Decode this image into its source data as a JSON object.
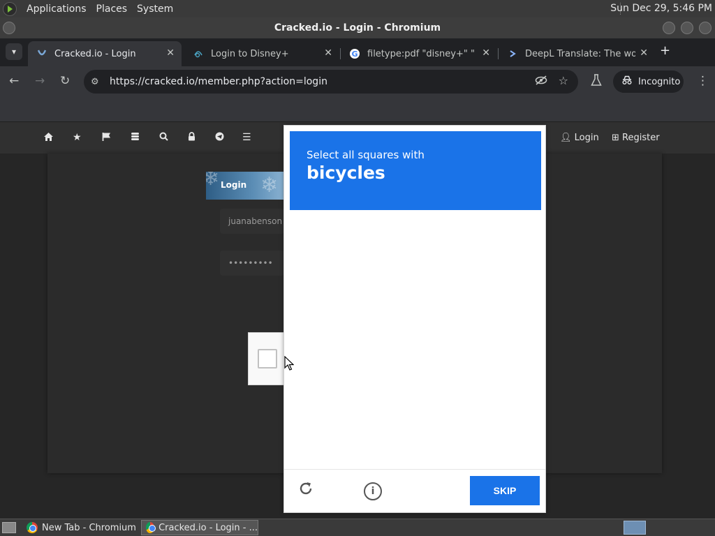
{
  "system_panel": {
    "menus": [
      "Applications",
      "Places",
      "System"
    ],
    "clock": "Sun Dec 29,  5:46 PM"
  },
  "window": {
    "title": "Cracked.io - Login - Chromium"
  },
  "tabs": [
    {
      "title": "Cracked.io - Login",
      "active": true
    },
    {
      "title": "Login to Disney+",
      "active": false
    },
    {
      "title": "filetype:pdf \"disney+\" \"",
      "active": false
    },
    {
      "title": "DeepL Translate: The worl",
      "active": false
    }
  ],
  "toolbar": {
    "url": "https://cracked.io/member.php?action=login",
    "incognito_label": "Incognito"
  },
  "site_nav": {
    "login_label": "Login",
    "register_label": "Register"
  },
  "login_form": {
    "header": "Login",
    "username_value": "juanabenson",
    "password_value": "•••••••••"
  },
  "captcha": {
    "prompt_line1": "Select all squares with",
    "prompt_object": "bicycles",
    "skip_label": "SKIP",
    "accent_color": "#1a73e8"
  },
  "taskbar": {
    "items": [
      {
        "label": "New Tab - Chromium",
        "active": false
      },
      {
        "label": "Cracked.io - Login - ...",
        "active": true
      }
    ]
  }
}
